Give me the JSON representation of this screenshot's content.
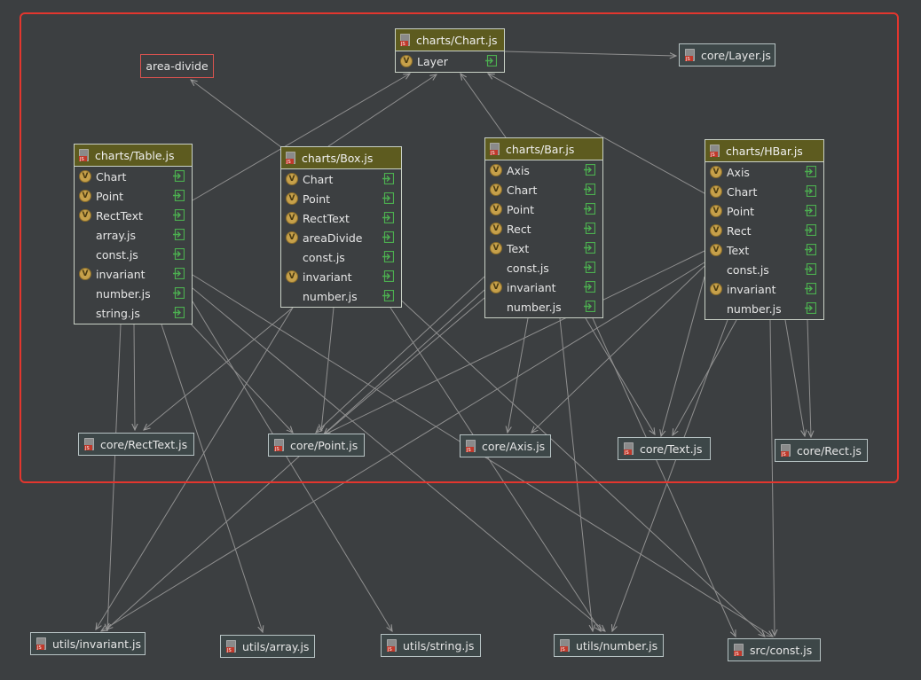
{
  "group": {
    "label": "area-divide"
  },
  "modules": [
    {
      "id": "chart",
      "title": "charts/Chart.js",
      "items": [
        {
          "name": "Layer",
          "v": true
        }
      ]
    },
    {
      "id": "table",
      "title": "charts/Table.js",
      "items": [
        {
          "name": "Chart",
          "v": true
        },
        {
          "name": "Point",
          "v": true
        },
        {
          "name": "RectText",
          "v": true
        },
        {
          "name": "array.js",
          "v": false
        },
        {
          "name": "const.js",
          "v": false
        },
        {
          "name": "invariant",
          "v": true
        },
        {
          "name": "number.js",
          "v": false
        },
        {
          "name": "string.js",
          "v": false
        }
      ]
    },
    {
      "id": "box",
      "title": "charts/Box.js",
      "items": [
        {
          "name": "Chart",
          "v": true
        },
        {
          "name": "Point",
          "v": true
        },
        {
          "name": "RectText",
          "v": true
        },
        {
          "name": "areaDivide",
          "v": true
        },
        {
          "name": "const.js",
          "v": false
        },
        {
          "name": "invariant",
          "v": true
        },
        {
          "name": "number.js",
          "v": false
        }
      ]
    },
    {
      "id": "bar",
      "title": "charts/Bar.js",
      "items": [
        {
          "name": "Axis",
          "v": true
        },
        {
          "name": "Chart",
          "v": true
        },
        {
          "name": "Point",
          "v": true
        },
        {
          "name": "Rect",
          "v": true
        },
        {
          "name": "Text",
          "v": true
        },
        {
          "name": "const.js",
          "v": false
        },
        {
          "name": "invariant",
          "v": true
        },
        {
          "name": "number.js",
          "v": false
        }
      ]
    },
    {
      "id": "hbar",
      "title": "charts/HBar.js",
      "items": [
        {
          "name": "Axis",
          "v": true
        },
        {
          "name": "Chart",
          "v": true
        },
        {
          "name": "Point",
          "v": true
        },
        {
          "name": "Rect",
          "v": true
        },
        {
          "name": "Text",
          "v": true
        },
        {
          "name": "const.js",
          "v": false
        },
        {
          "name": "invariant",
          "v": true
        },
        {
          "name": "number.js",
          "v": false
        }
      ]
    }
  ],
  "files": [
    {
      "id": "layer",
      "label": "core/Layer.js"
    },
    {
      "id": "recttext",
      "label": "core/RectText.js"
    },
    {
      "id": "point",
      "label": "core/Point.js"
    },
    {
      "id": "axis",
      "label": "core/Axis.js"
    },
    {
      "id": "text",
      "label": "core/Text.js"
    },
    {
      "id": "rect",
      "label": "core/Rect.js"
    },
    {
      "id": "invariant",
      "label": "utils/invariant.js"
    },
    {
      "id": "array",
      "label": "utils/array.js"
    },
    {
      "id": "string",
      "label": "utils/string.js"
    },
    {
      "id": "number",
      "label": "utils/number.js"
    },
    {
      "id": "const",
      "label": "src/const.js"
    }
  ],
  "colors": {
    "background": "#3c3f41",
    "frame": "#e3362e",
    "header": "#5d5b1f",
    "edge": "#8f8f8f",
    "badge": "#c6a04a",
    "pin": "#4caf50"
  },
  "icons": {
    "module": "js-file-icon",
    "member": "v-variable-badge",
    "pin": "export-pin-icon"
  }
}
